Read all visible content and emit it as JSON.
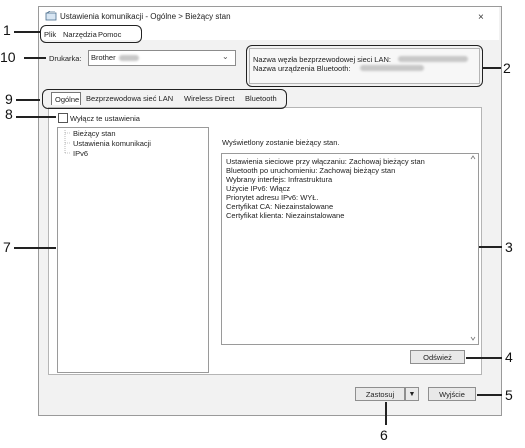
{
  "window": {
    "title": "Ustawienia komunikacji - Ogólne > Bieżący stan",
    "close_glyph": "×"
  },
  "menu": {
    "items": [
      "Plik",
      "Narzędzia",
      "Pomoc"
    ]
  },
  "printer": {
    "label": "Drukarka:",
    "value": "Brother"
  },
  "info": {
    "wlan_label": "Nazwa węzła bezprzewodowej sieci LAN:",
    "bt_label": "Nazwa urządzenia Bluetooth:"
  },
  "tabs": [
    "Ogólne",
    "Bezprzewodowa sieć LAN",
    "Wireless Direct",
    "Bluetooth"
  ],
  "disable_checkbox": {
    "label": "Wyłącz te ustawienia",
    "checked": false
  },
  "tree": {
    "items": [
      "Bieżący stan",
      "Ustawienia komunikacji",
      "IPv6"
    ]
  },
  "status": {
    "heading": "Wyświetlony zostanie bieżący stan.",
    "lines": [
      "Ustawienia sieciowe przy włączaniu: Zachowaj bieżący stan",
      "Bluetooth po uruchomieniu: Zachowaj bieżący stan",
      "Wybrany interfejs: Infrastruktura",
      "Użycie IPv6: Włącz",
      "Priorytet adresu IPv6: WYŁ.",
      "Certyfikat CA: Niezainstalowane",
      "Certyfikat klienta: Niezainstalowane"
    ]
  },
  "buttons": {
    "refresh": "Odśwież",
    "apply": "Zastosuj",
    "exit": "Wyjście"
  },
  "callouts": [
    "1",
    "2",
    "3",
    "4",
    "5",
    "6",
    "7",
    "8",
    "9",
    "10"
  ]
}
